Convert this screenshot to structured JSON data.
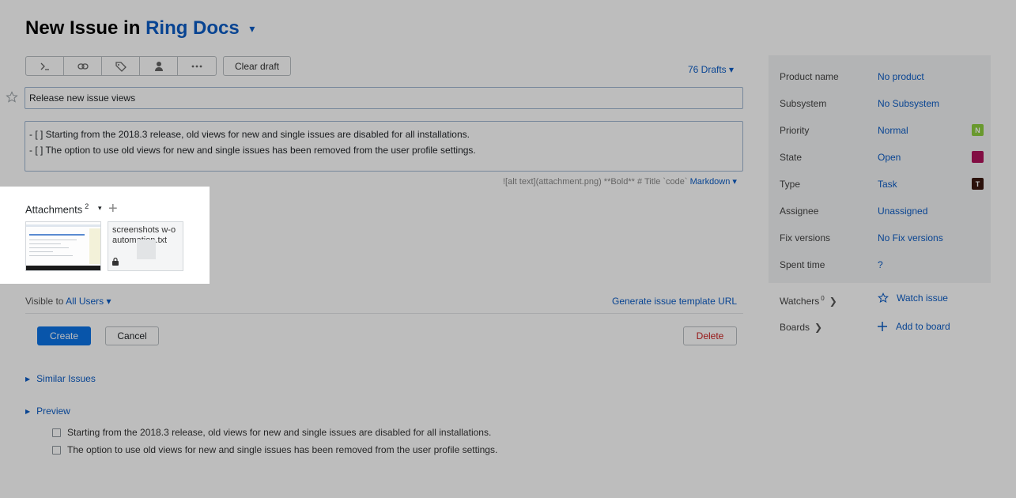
{
  "header": {
    "title_prefix": "New Issue in",
    "project": "Ring Docs",
    "project_caret": "▾"
  },
  "toolbar": {
    "icons": [
      "terminal-icon",
      "link-icon",
      "tag-icon",
      "user-icon",
      "more-icon"
    ],
    "clear_draft": "Clear draft",
    "drafts": "76 Drafts ▾"
  },
  "issue": {
    "summary": "Release new issue views",
    "description_lines": [
      "- [ ] Starting from the 2018.3 release, old views for new and single issues are disabled for all installations.",
      "- [ ] The option to use old views for new and single issues has been removed from the user profile settings."
    ],
    "hint": "![alt text](attachment.png) **Bold** # Title `code`",
    "markdown": "Markdown ▾"
  },
  "attachments": {
    "label": "Attachments",
    "count": "2",
    "caret": "▾",
    "add": "+",
    "file_name": "screenshots w-o automation.txt"
  },
  "visibility": {
    "prefix": "Visible to",
    "value": "All Users ▾",
    "template_url": "Generate issue template URL"
  },
  "actions": {
    "create": "Create",
    "cancel": "Cancel",
    "delete": "Delete"
  },
  "sections": {
    "similar": "Similar Issues",
    "preview": "Preview",
    "preview_items": [
      "Starting from the 2018.3 release, old views for new and single issues are disabled for all installations.",
      "The option to use old views for new and single issues has been removed from the user profile settings."
    ]
  },
  "fields": [
    {
      "label": "Product name",
      "value": "No product"
    },
    {
      "label": "Subsystem",
      "value": "No Subsystem"
    },
    {
      "label": "Priority",
      "value": "Normal",
      "badge": "N",
      "badge_color": "#8ecf3f"
    },
    {
      "label": "State",
      "value": "Open",
      "badge": "",
      "badge_color": "#b0125b"
    },
    {
      "label": "Type",
      "value": "Task",
      "badge": "T",
      "badge_color": "#3b1710"
    },
    {
      "label": "Assignee",
      "value": "Unassigned"
    },
    {
      "label": "Fix versions",
      "value": "No Fix versions"
    },
    {
      "label": "Spent time",
      "value": "?"
    }
  ],
  "extras": {
    "watchers": "Watchers",
    "watchers_count": "0",
    "watch_issue": "Watch issue",
    "boards": "Boards",
    "add_to_board": "Add to board"
  }
}
